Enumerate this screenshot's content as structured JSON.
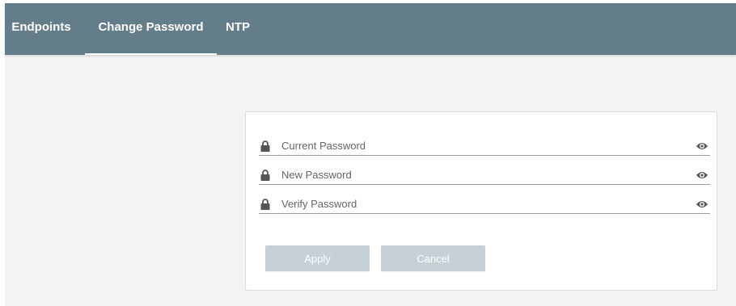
{
  "tabs": [
    {
      "label": "Endpoints",
      "active": false
    },
    {
      "label": "Change Password",
      "active": true
    },
    {
      "label": "NTP",
      "active": false
    }
  ],
  "form": {
    "fields": [
      {
        "placeholder": "Current Password",
        "value": "",
        "icon": "lock-icon",
        "action_icon": "eye-icon"
      },
      {
        "placeholder": "New Password",
        "value": "",
        "icon": "lock-icon",
        "action_icon": "eye-icon"
      },
      {
        "placeholder": "Verify Password",
        "value": "",
        "icon": "lock-icon",
        "action_icon": "eye-icon"
      }
    ],
    "buttons": {
      "apply_label": "Apply",
      "cancel_label": "Cancel"
    }
  },
  "colors": {
    "header_bg": "#637e8a",
    "page_bg": "#f3f3f3",
    "button_bg": "#c5d1d6",
    "icon": "#555555"
  }
}
